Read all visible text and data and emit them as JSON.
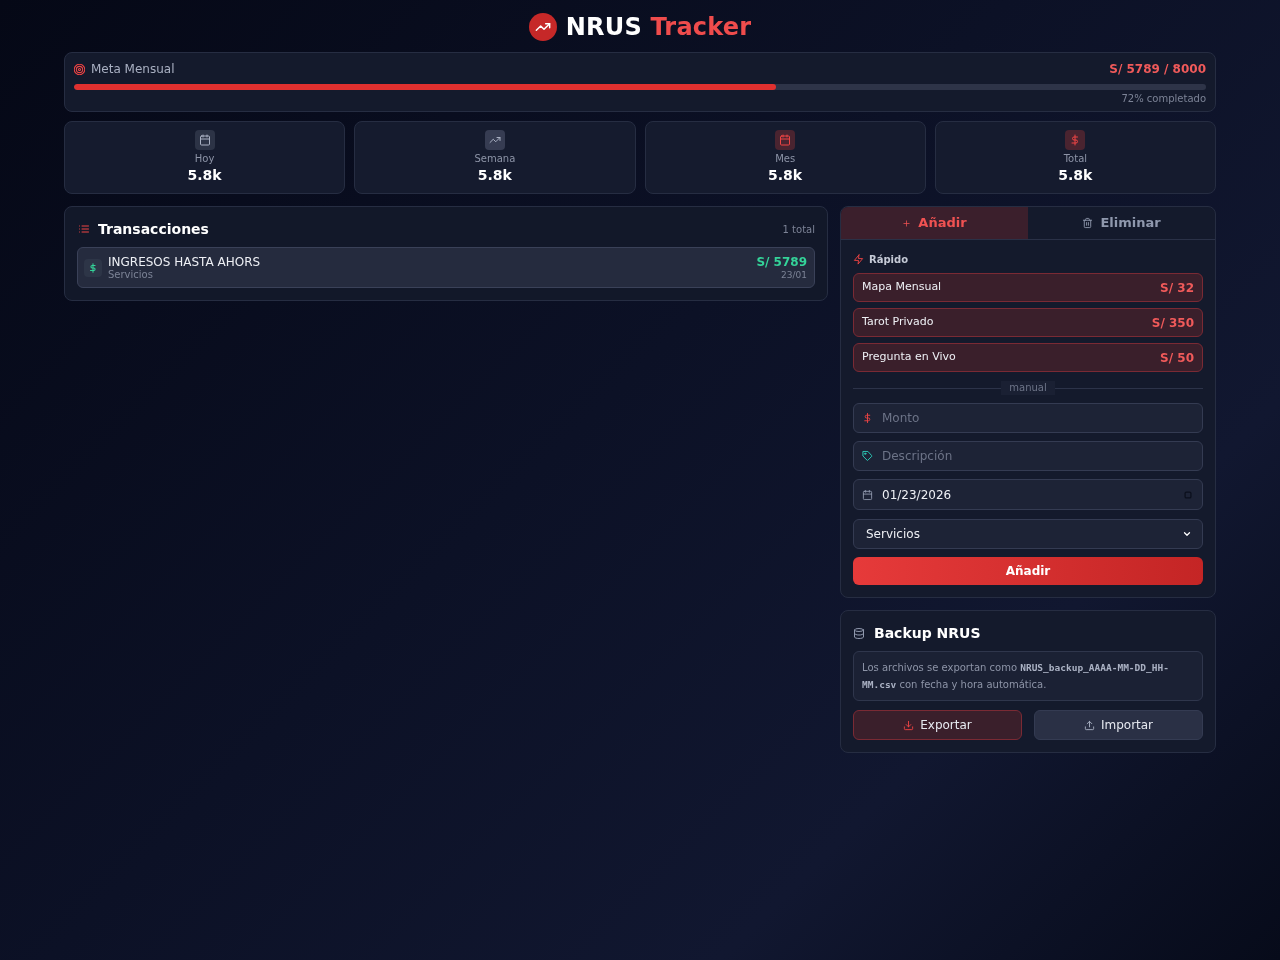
{
  "header": {
    "brand": "NRUS",
    "accent": "Tracker"
  },
  "goal": {
    "label": "Meta Mensual",
    "amount": "S/ 5789 / 8000",
    "level": 0.62,
    "caption": "72% completado"
  },
  "stats": [
    {
      "kind": "today",
      "label": "Hoy",
      "value": "5.8k"
    },
    {
      "kind": "week",
      "label": "Semana",
      "value": "5.8k"
    },
    {
      "kind": "month",
      "label": "Mes",
      "value": "5.8k"
    },
    {
      "kind": "total",
      "label": "Total",
      "value": "5.8k"
    }
  ],
  "transactions": {
    "title": "Transacciones",
    "count": "1 total",
    "rows": [
      {
        "title": "INGRESOS HASTA AHORS",
        "category": "Servicios",
        "amount": "S/ 5789",
        "date": "23/01"
      }
    ]
  },
  "tabs": [
    {
      "kind": "add",
      "label": "Añadir",
      "selected": true
    },
    {
      "kind": "delete",
      "label": "Eliminar",
      "selected": false
    }
  ],
  "form": {
    "section_label": "Rápido",
    "quick": [
      {
        "label": "Mapa Mensual",
        "amount": "S/ 32"
      },
      {
        "label": "Tarot Privado",
        "amount": "S/ 350"
      },
      {
        "label": "Pregunta en Vivo",
        "amount": "S/ 50"
      }
    ],
    "divider": "manual",
    "amount": {
      "placeholder": "Monto"
    },
    "description": {
      "placeholder": "Descripción"
    },
    "date": {
      "value": "01/23/2026"
    },
    "category": {
      "value": "Servicios"
    },
    "submit": "Añadir"
  },
  "backup": {
    "title": "Backup NRUS",
    "info": {
      "before": "Los archivos se exportan como ",
      "code": "NRUS_backup_AAAA-MM-DD_HH-MM.csv",
      "after": " con fecha y hora automática."
    },
    "buttons": [
      {
        "kind": "export",
        "label": "Exportar"
      },
      {
        "kind": "import",
        "label": "Importar"
      }
    ]
  }
}
